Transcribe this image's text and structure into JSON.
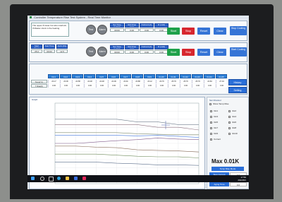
{
  "window": {
    "title": "Controller Temperature Rise Test System - Real Time Monitor"
  },
  "description": "The upper & lower hot wire interlock. If Master clock in the heating.",
  "round_buttons": [
    {
      "label": "Test"
    },
    {
      "label": "Alarm"
    }
  ],
  "params_top": {
    "headers": [
      "Set Time (H:M:S)",
      "Volt Drop (mV)",
      "Current (A)",
      "R (mΩ)"
    ],
    "values": [
      "00:00",
      "0.00",
      "0.00",
      "0.00"
    ]
  },
  "params_bottom": {
    "headers": [
      "Set Time (H:M:S)",
      "Volt Drop (mV)",
      "Current (A)",
      "R (mΩ)"
    ],
    "values": [
      "00:00",
      "0.00",
      "0.00",
      "0.00"
    ]
  },
  "left_inputs": {
    "headers": [
      "Start Temp",
      "Test Time",
      "Amb (Pa)"
    ],
    "values": [
      "25.0",
      "00:00",
      "12.5"
    ]
  },
  "actions_top": {
    "start": "Start",
    "stop": "Stop",
    "reset": "Reset",
    "clear": "Clear",
    "cool": "Stop Cooling"
  },
  "actions_bottom": {
    "start": "Start",
    "stop": "Stop",
    "reset": "Reset",
    "clear": "Clear",
    "cool": "Start Cooling"
  },
  "channels": {
    "labels": [
      "CH1",
      "CH2",
      "CH3",
      "CH4",
      "CH5",
      "CH6",
      "CH7",
      "CH8",
      "CH9",
      "CH10",
      "CH11",
      "CH12",
      "CH13",
      "CH14",
      "CH15"
    ],
    "temps": [
      "23.17",
      "23.06",
      "24.58",
      "24.48",
      "24.48",
      "24.09",
      "23.91",
      "23.88",
      "23.12",
      "23.76",
      "25.79",
      "25.76",
      "25.79",
      "24.84",
      "27.04"
    ],
    "rises": [
      "0.00",
      "0.00",
      "0.00",
      "0.00",
      "0.00",
      "0.00",
      "0.00",
      "0.00",
      "0.00",
      "0.00",
      "0.00",
      "0.00",
      "0.00",
      "0.00",
      "0.00"
    ],
    "row_labels": [
      "Temp(°C)",
      "T Rise(K)"
    ]
  },
  "side_buttons": {
    "history": "History",
    "setting": "Setting"
  },
  "chart_panel": {
    "title": "Graph"
  },
  "chart_data": {
    "type": "line",
    "title": "",
    "xlabel": "",
    "ylabel": "",
    "series": [
      {
        "values": [
          24,
          24,
          24,
          24,
          23,
          23,
          22,
          22
        ],
        "color": "#6e7c8a"
      },
      {
        "values": [
          22,
          22,
          22,
          22,
          22,
          21,
          21,
          20
        ],
        "color": "#8a6e7c"
      },
      {
        "values": [
          19,
          19,
          19,
          19,
          18.6,
          18.4,
          18.2,
          18.2
        ],
        "color": "#7c8a6e"
      },
      {
        "values": [
          18,
          18,
          18,
          18,
          17.8,
          18,
          17.6,
          17.2
        ],
        "color": "#4a7de0"
      },
      {
        "values": [
          15,
          15,
          15.5,
          16,
          16.4,
          17,
          16.6,
          16.4
        ],
        "color": "#805a8a"
      },
      {
        "values": [
          14,
          14,
          13.6,
          13.4,
          12.6,
          12.4,
          12.2,
          11.8
        ],
        "color": "#8a6d5a"
      },
      {
        "values": [
          11,
          11,
          11,
          10.6,
          10.2,
          10,
          10,
          9.6
        ],
        "color": "#6d8a5a"
      },
      {
        "values": [
          8,
          8,
          8,
          7.6,
          7.4,
          7,
          7,
          6.8
        ],
        "color": "#5a6d8a"
      }
    ],
    "x": [
      0,
      1,
      2,
      3,
      4,
      5,
      6,
      7
    ],
    "ylim": [
      0,
      30
    ],
    "grid": true,
    "legend": "none"
  },
  "side_panel": {
    "title": "Set Channel",
    "show_temp": "Show Temp Rise",
    "checkboxes": [
      "CH1",
      "CH2",
      "CH3",
      "CH4",
      "CH5",
      "CH6",
      "CH7",
      "CH8",
      "CH9",
      "CH10",
      "Current"
    ],
    "max_label": "Max 0.01K",
    "buttons": [
      "Temp Rise Mode",
      "Stop Current",
      "Stop Temp",
      "Aging Time"
    ],
    "button_values": [
      "",
      "0.0",
      "0.0",
      "0.0"
    ]
  },
  "taskbar": {
    "time": "17:56",
    "date": "2024/8/1"
  }
}
